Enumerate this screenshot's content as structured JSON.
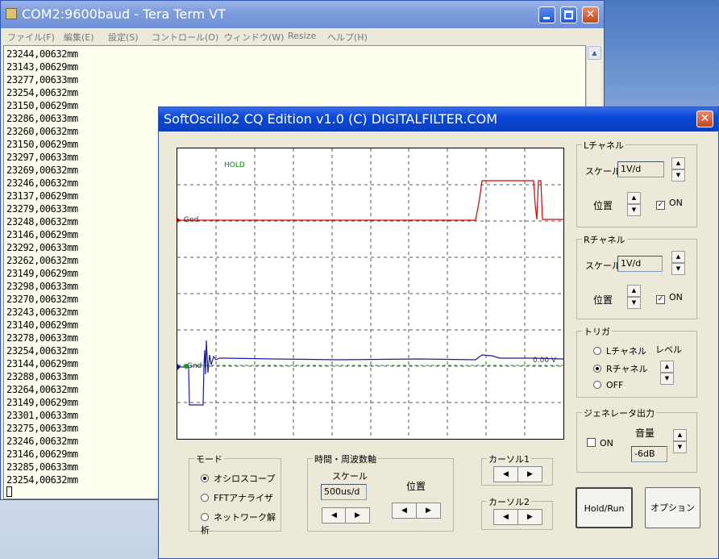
{
  "teraterm": {
    "title": "COM2:9600baud - Tera Term VT",
    "menu": [
      "ファイル(F)",
      "編集(E)",
      "設定(S)",
      "コントロール(O)",
      "ウィンドウ(W)",
      "Resize",
      "ヘルプ(H)"
    ],
    "lines": [
      "23244,00632mm",
      "23143,00629mm",
      "23277,00633mm",
      "23254,00632mm",
      "23150,00629mm",
      "23286,00633mm",
      "23260,00632mm",
      "23150,00629mm",
      "23297,00633mm",
      "23269,00632mm",
      "23246,00632mm",
      "23137,00629mm",
      "23279,00633mm",
      "23248,00632mm",
      "23146,00629mm",
      "23292,00633mm",
      "23262,00632mm",
      "23149,00629mm",
      "23298,00633mm",
      "23270,00632mm",
      "23243,00632mm",
      "23140,00629mm",
      "23278,00633mm",
      "23254,00632mm",
      "23144,00629mm",
      "23288,00633mm",
      "23264,00632mm",
      "23149,00629mm",
      "23301,00633mm",
      "23275,00633mm",
      "23246,00632mm",
      "23146,00629mm",
      "23285,00633mm",
      "23254,00632mm"
    ]
  },
  "osc": {
    "title": "SoftOscillo2 CQ Edition v1.0 (C) DIGITALFILTER.COM",
    "scope": {
      "hold": "HOLD",
      "gnd_l": "Gnd",
      "gnd_r": "Gnd",
      "readout": "0.00 V"
    },
    "lch": {
      "label": "Lチャネル",
      "scale_label": "スケール",
      "scale": "1V/d",
      "pos_label": "位置",
      "on": "ON"
    },
    "rch": {
      "label": "Rチャネル",
      "scale_label": "スケール",
      "scale": "1V/d",
      "pos_label": "位置",
      "on": "ON"
    },
    "trigger": {
      "label": "トリガ",
      "level": "レベル",
      "options": [
        "Lチャネル",
        "Rチャネル",
        "OFF"
      ],
      "selected": 1
    },
    "generator": {
      "label": "ジェネレータ出力",
      "volume_label": "音量",
      "volume": "-6dB",
      "on": "ON"
    },
    "mode": {
      "label": "モード",
      "options": [
        "オシロスコープ",
        "FFTアナライザ",
        "ネットワーク解析"
      ],
      "selected": 0
    },
    "time": {
      "label": "時間・周波数軸",
      "scale_label": "スケール",
      "scale": "500us/d",
      "pos_label": "位置"
    },
    "cursor1": "カーソル1",
    "cursor2": "カーソル2",
    "hold_run": "Hold/Run",
    "option": "オプション"
  },
  "colors": {
    "ch_l": "#d40000",
    "ch_r": "#1c1ca0",
    "trig": "#1a9a1a"
  }
}
